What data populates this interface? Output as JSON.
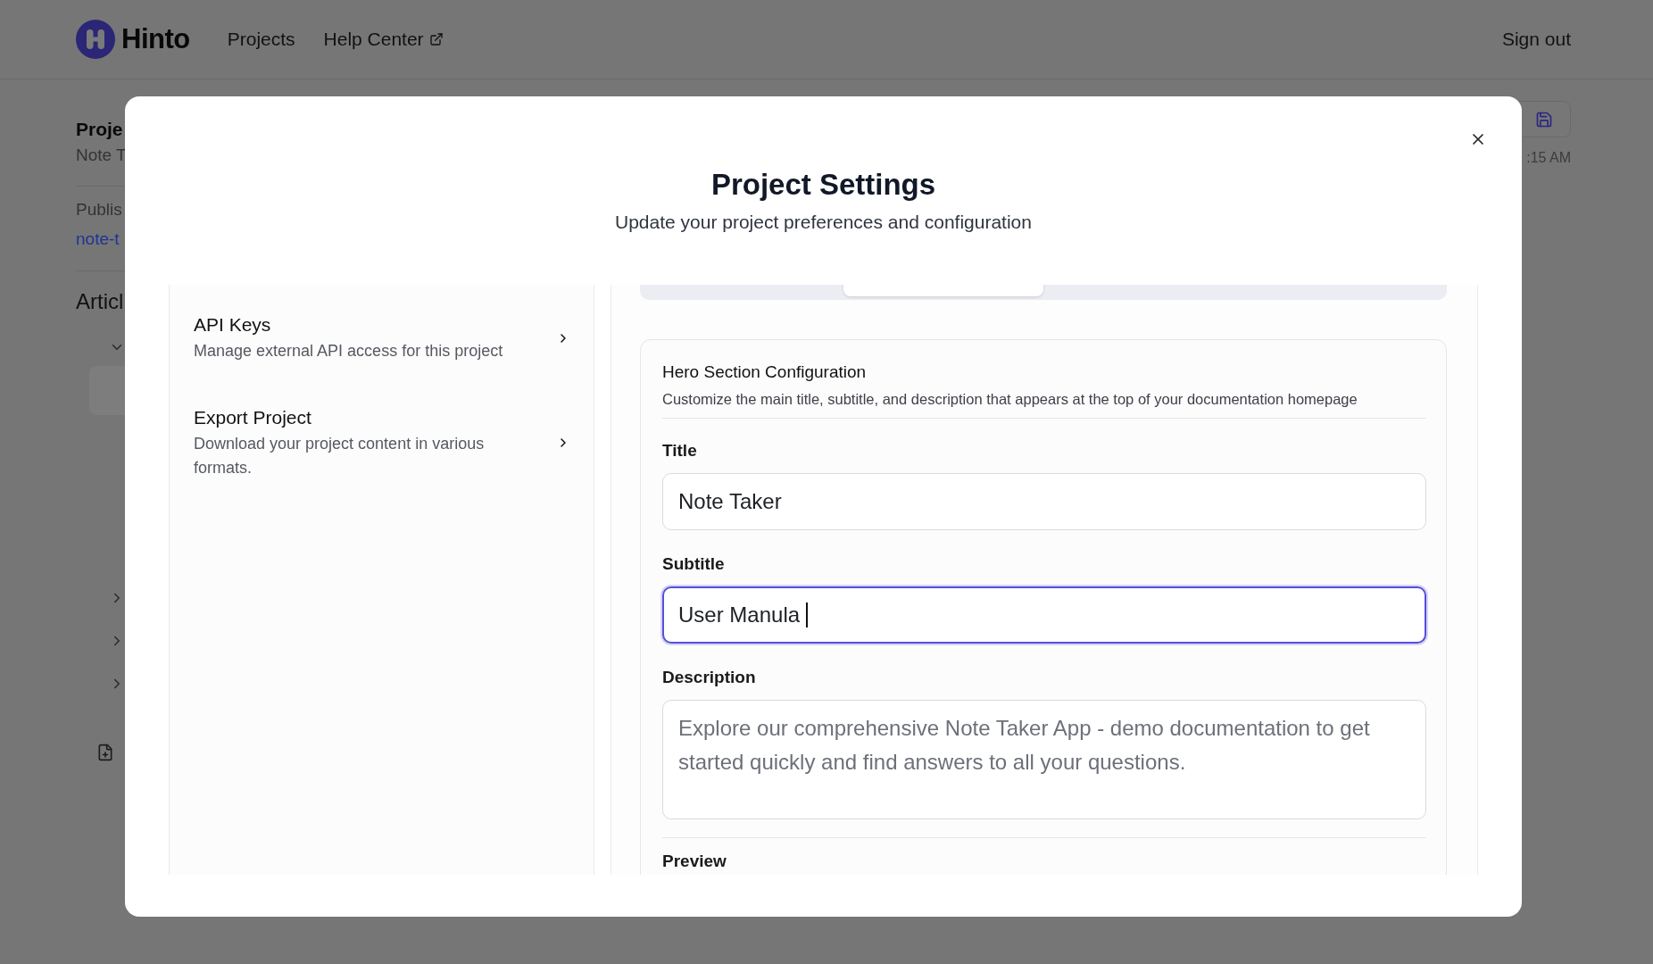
{
  "header": {
    "logo": "Hinto",
    "nav": [
      {
        "label": "Projects",
        "external": false
      },
      {
        "label": "Help Center",
        "external": true
      }
    ],
    "sign_out": "Sign out"
  },
  "background_page": {
    "sidebar": {
      "title": "Proje",
      "subtitle": "Note T",
      "published_label": "Publis",
      "published_link": "note-t",
      "section_heading": "Articl",
      "groups": [
        {
          "expanded": true
        },
        {
          "expanded": false
        },
        {
          "expanded": false
        },
        {
          "expanded": false
        }
      ]
    },
    "timestamp": ":15 AM"
  },
  "modal": {
    "title": "Project Settings",
    "subtitle": "Update your project preferences and configuration",
    "menu": [
      {
        "title": "API Keys",
        "description": "Manage external API access for this project"
      },
      {
        "title": "Export Project",
        "description": "Download your project content in various formats."
      }
    ],
    "tabs": [
      {
        "selected": false
      },
      {
        "selected": true
      },
      {
        "selected": false
      },
      {
        "selected": false
      }
    ],
    "card": {
      "title": "Hero Section Configuration",
      "description": "Customize the main title, subtitle, and description that appears at the top of your documentation homepage",
      "fields": [
        {
          "kind": "input",
          "label": "Title",
          "value": "Note Taker",
          "focused": false
        },
        {
          "kind": "input",
          "label": "Subtitle",
          "value": "User Manula",
          "focused": true
        },
        {
          "kind": "textarea",
          "label": "Description",
          "placeholder": "Explore our comprehensive Note Taker App - demo documentation to get started quickly and find answers to all your questions.",
          "focused": false
        }
      ],
      "preview_label": "Preview"
    }
  }
}
